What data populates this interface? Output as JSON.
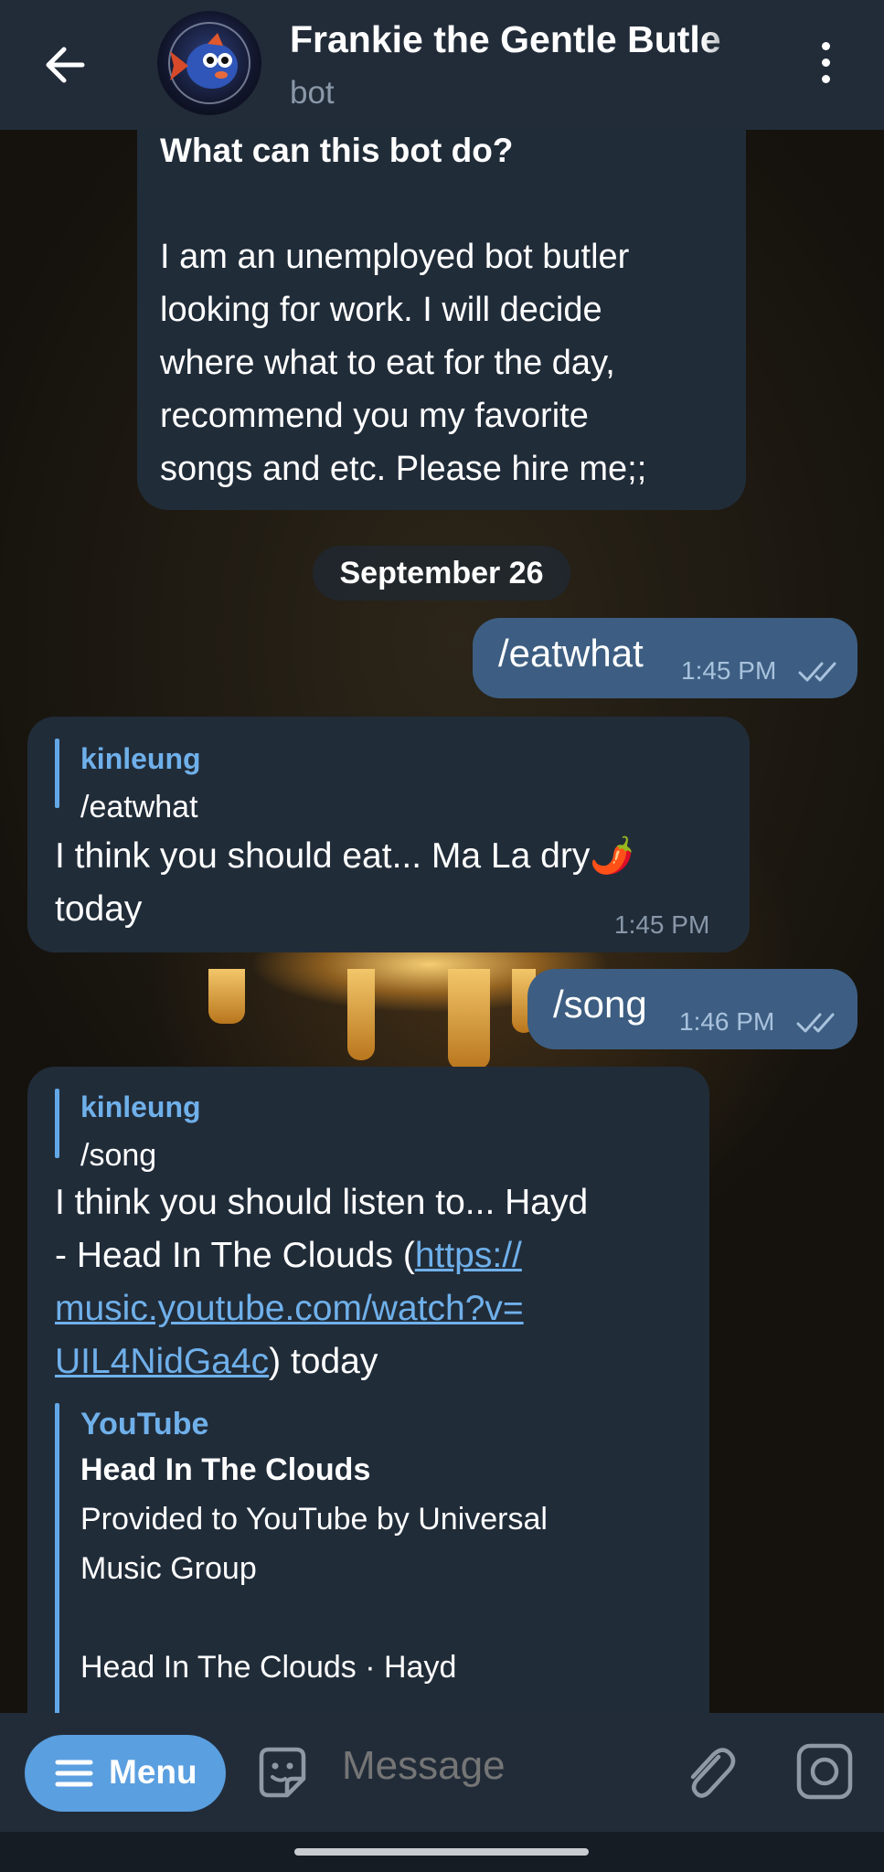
{
  "header": {
    "title": "Frankie the Gentle Butle",
    "subtitle": "bot",
    "back_icon": "arrow-left-icon",
    "more_icon": "more-vertical-icon"
  },
  "intro": {
    "heading": "What can this bot do?",
    "lines": [
      "I am an unemployed bot butler",
      "looking for work. I will decide",
      "where what to eat for the day,",
      "recommend you my favorite",
      "songs and etc. Please hire me;;"
    ]
  },
  "date_chip": "September 26",
  "messages": [
    {
      "text": "/eatwhat",
      "time": "1:45 PM",
      "status_icon": "double-check-icon"
    },
    {
      "reply_name": "kinleung",
      "reply_text": "/eatwhat",
      "lines": [
        "I think you should eat... Ma La dry🌶️",
        "today"
      ],
      "time": "1:45 PM"
    },
    {
      "text": "/song",
      "time": "1:46 PM",
      "status_icon": "double-check-icon"
    },
    {
      "reply_name": "kinleung",
      "reply_text": "/song",
      "line1": "I think you should listen to... Hayd",
      "line2_pre": "- Head In The Clouds (",
      "line2_link": "https://",
      "line3_link": "music.youtube.com/watch?v=",
      "line4_link": "UIL4NidGa4c",
      "line4_post": ") today",
      "preview": {
        "site": "YouTube",
        "title": "Head In The Clouds",
        "desc_lines": [
          "Provided to YouTube by Universal",
          "Music Group",
          "",
          "Head In The Clouds · Hayd"
        ]
      }
    }
  ],
  "input_bar": {
    "menu_label": "Menu",
    "placeholder": "Message",
    "sticker_icon": "sticker-icon",
    "attach_icon": "paperclip-icon",
    "camera_icon": "camera-icon"
  },
  "colors": {
    "header_bg": "#222c39",
    "incoming_bubble": "#212c39",
    "outgoing_bubble": "#3d5e82",
    "accent": "#5a9fe0",
    "link": "#6fb0ea"
  }
}
